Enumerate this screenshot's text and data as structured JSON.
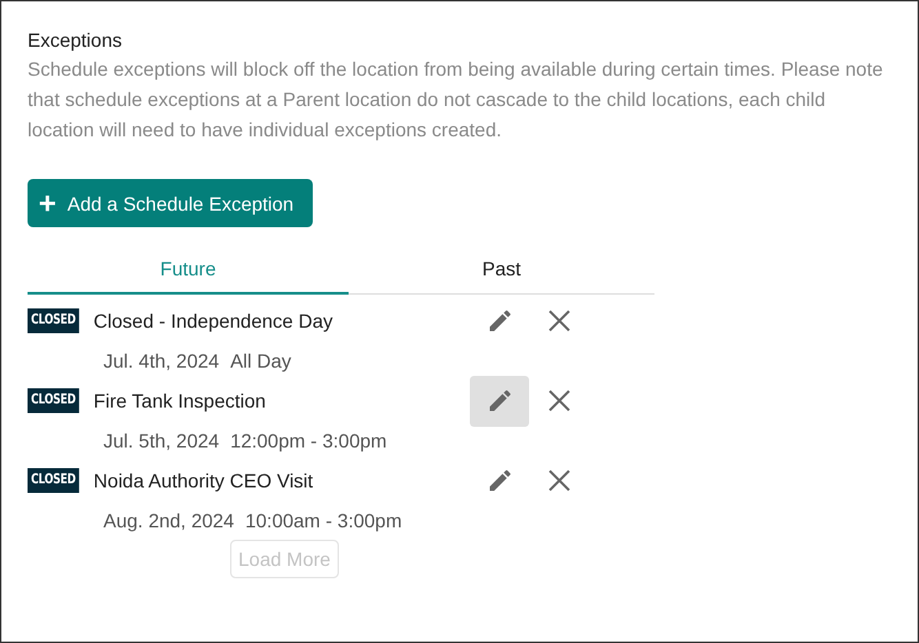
{
  "section": {
    "title": "Exceptions",
    "description": "Schedule exceptions will block off the location from being available during certain times. Please note that schedule exceptions at a Parent location do not cascade to the child locations, each child location will need to have individual exceptions created."
  },
  "add_button": {
    "icon": "+",
    "label": "Add a Schedule Exception"
  },
  "tabs": [
    {
      "label": "Future",
      "selected": true
    },
    {
      "label": "Past",
      "selected": false
    }
  ],
  "exceptions": [
    {
      "badge": "CLOSED",
      "title": "Closed - Independence Day",
      "date": "Jul. 4th, 2024",
      "time": "All Day",
      "edit_highlighted": false
    },
    {
      "badge": "CLOSED",
      "title": "Fire Tank Inspection",
      "date": "Jul. 5th, 2024",
      "time": "12:00pm - 3:00pm",
      "edit_highlighted": true
    },
    {
      "badge": "CLOSED",
      "title": "Noida Authority CEO Visit",
      "date": "Aug. 2nd, 2024",
      "time": "10:00am - 3:00pm",
      "edit_highlighted": false
    }
  ],
  "load_more": {
    "label": "Load More",
    "disabled": true
  }
}
